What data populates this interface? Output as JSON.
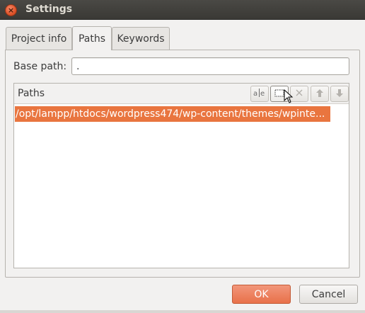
{
  "window": {
    "title": "Settings",
    "close_glyph": "×"
  },
  "tabs": [
    {
      "label": "Project info"
    },
    {
      "label": "Paths",
      "active": true
    },
    {
      "label": "Keywords"
    }
  ],
  "form": {
    "base_path_label": "Base path:",
    "base_path_value": "."
  },
  "paths": {
    "header": "Paths",
    "toolbar": [
      {
        "icon": "rename-icon",
        "glyph": "a|e",
        "enabled": true
      },
      {
        "icon": "add-folder-icon",
        "glyph": "▭",
        "enabled": true
      },
      {
        "icon": "delete-icon",
        "glyph": "✕",
        "enabled": false
      },
      {
        "icon": "move-up-icon",
        "glyph": "🡅",
        "enabled": false
      },
      {
        "icon": "move-down-icon",
        "glyph": "🡇",
        "enabled": false
      }
    ],
    "items": [
      "/opt/lampp/htdocs/wordpress474/wp-content/themes/wpinte..."
    ]
  },
  "buttons": {
    "ok_label": "OK",
    "cancel_label": "Cancel"
  },
  "colors": {
    "accent": "#e9753f",
    "titlebar": "#3c3b37"
  }
}
